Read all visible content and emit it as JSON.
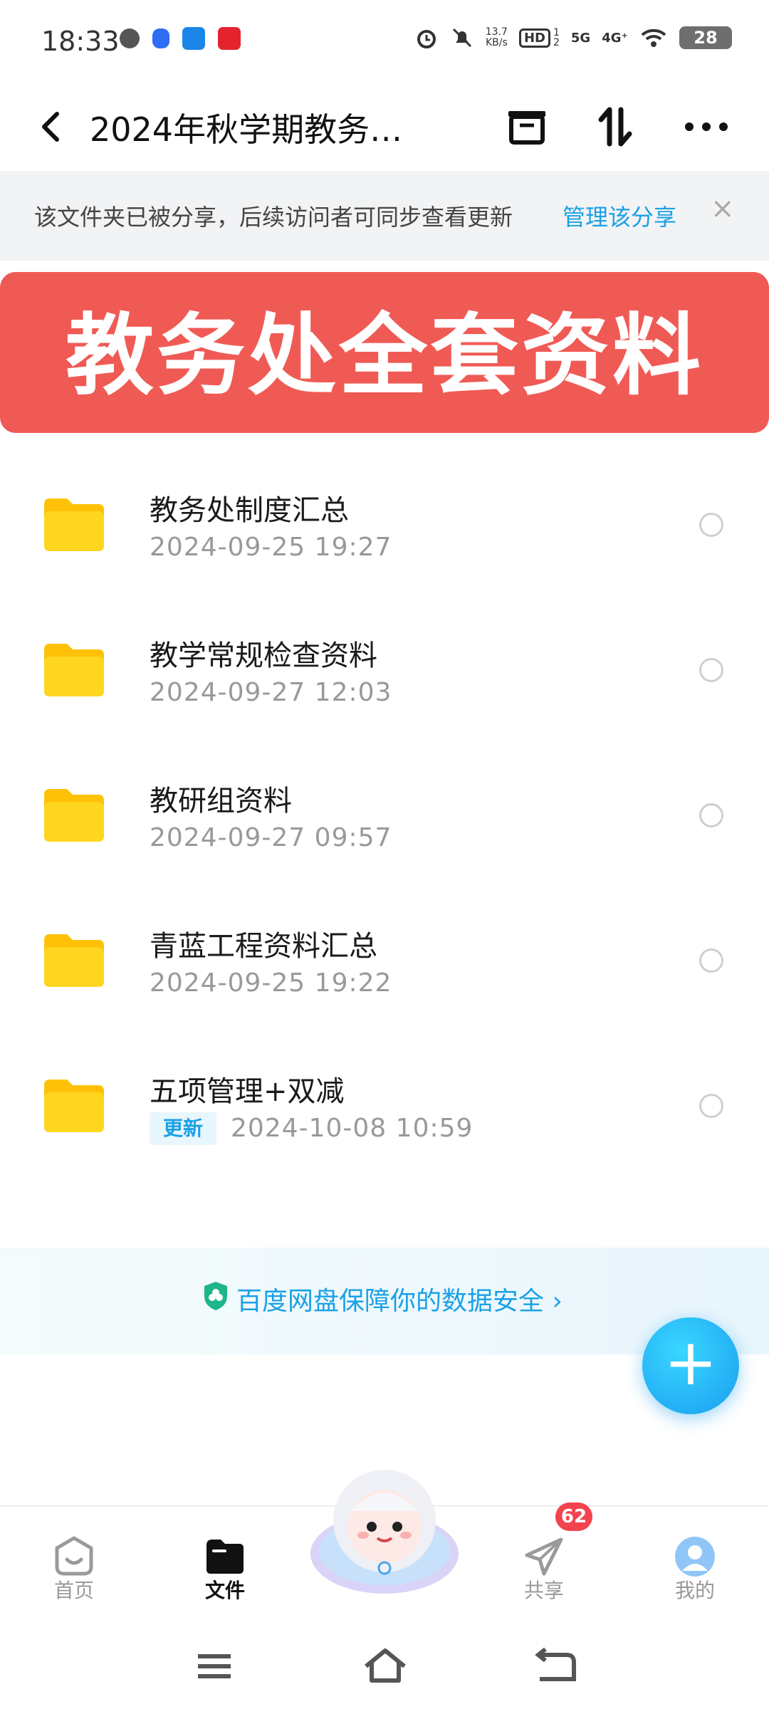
{
  "status_bar": {
    "time": "18:33",
    "net_speed_value": "13.7",
    "net_speed_unit": "KB/s",
    "hd": "HD",
    "hd_sub": "1",
    "hd_sub2": "2",
    "sig1": "5G",
    "sig2": "4G⁺",
    "battery": "28"
  },
  "header": {
    "back_icon": "chevron-left",
    "title": "2024年秋学期教务…",
    "icons": [
      "archive-box-icon",
      "sort-updown-icon",
      "more-dots-icon"
    ]
  },
  "share_banner": {
    "message": "该文件夹已被分享，后续访问者可同步查看更新",
    "manage_link": "管理该分享",
    "close": "×"
  },
  "overlay_caption": "教务处全套资料",
  "files": [
    {
      "name": "教务处制度汇总",
      "date": "2024-09-25  19:27",
      "badge": ""
    },
    {
      "name": "教学常规检查资料",
      "date": "2024-09-27  12:03",
      "badge": ""
    },
    {
      "name": "教研组资料",
      "date": "2024-09-27  09:57",
      "badge": ""
    },
    {
      "name": "青蓝工程资料汇总",
      "date": "2024-09-25  19:22",
      "badge": ""
    },
    {
      "name": "五项管理+双减",
      "date": "2024-10-08  10:59",
      "badge": "更新"
    }
  ],
  "security_notice": "百度网盘保障你的数据安全 ›",
  "fab_label": "+",
  "tabs": [
    {
      "label": "首页",
      "icon": "home-face-icon"
    },
    {
      "label": "文件",
      "icon": "folder-icon"
    },
    {
      "label": "共享",
      "icon": "paper-plane-icon",
      "badge": "62"
    },
    {
      "label": "我的",
      "icon": "avatar-icon"
    }
  ],
  "colors": {
    "accent": "#1aa1e5",
    "overlay_red": "#f05a55",
    "folder_yellow": "#ffd01a",
    "badge_red": "#f2434f"
  }
}
